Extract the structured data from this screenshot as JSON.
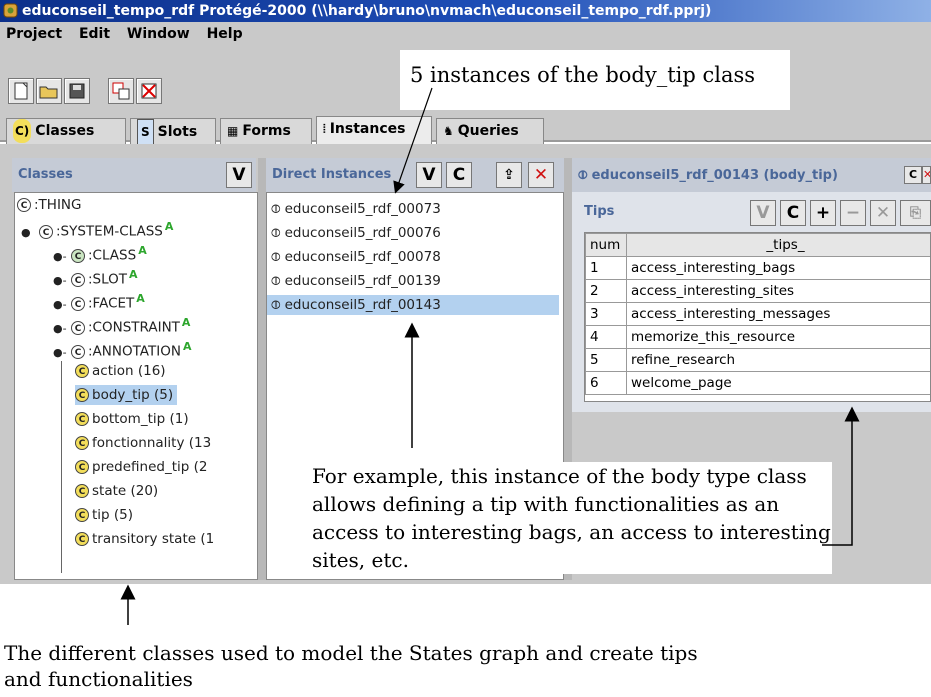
{
  "window": {
    "title": "educonseil_tempo_rdf  Protégé-2000   (\\\\hardy\\bruno\\nvmach\\educonseil_tempo_rdf.pprj)"
  },
  "menu": [
    "Project",
    "Edit",
    "Window",
    "Help"
  ],
  "tabs": [
    {
      "label": "Classes",
      "icon": "C)"
    },
    {
      "label": "Slots",
      "icon": "S"
    },
    {
      "label": "Forms",
      "icon": "▦"
    },
    {
      "label": "Instances",
      "icon": "⦙"
    },
    {
      "label": "Queries",
      "icon": "♞"
    }
  ],
  "classes_panel": {
    "header": "Classes",
    "view_button": "V",
    "tree": [
      {
        "label": ":THING",
        "icon": "C"
      },
      {
        "label": ":SYSTEM-CLASS",
        "icon": "C",
        "abstract": "A"
      },
      {
        "label": ":CLASS",
        "icon": "C",
        "abstract": "A"
      },
      {
        "label": ":SLOT",
        "icon": "C",
        "abstract": "A"
      },
      {
        "label": ":FACET",
        "icon": "C",
        "abstract": "A"
      },
      {
        "label": ":CONSTRAINT",
        "icon": "C",
        "abstract": "A"
      },
      {
        "label": ":ANNOTATION",
        "icon": "C",
        "abstract": "A"
      },
      {
        "label": "action  (16)",
        "icon": "C"
      },
      {
        "label": "body_tip  (5)",
        "icon": "C",
        "selected": true
      },
      {
        "label": "bottom_tip  (1)",
        "icon": "C"
      },
      {
        "label": "fonctionnality  (13",
        "icon": "C"
      },
      {
        "label": "predefined_tip  (2",
        "icon": "C"
      },
      {
        "label": "state  (20)",
        "icon": "C"
      },
      {
        "label": "tip  (5)",
        "icon": "C"
      },
      {
        "label": "transitory state  (1",
        "icon": "C"
      }
    ]
  },
  "instances_panel": {
    "header": "Direct Instances",
    "buttons": [
      "V",
      "C",
      "⇪",
      "✕"
    ],
    "items": [
      "educonseil5_rdf_00073",
      "educonseil5_rdf_00076",
      "educonseil5_rdf_00078",
      "educonseil5_rdf_00139",
      "educonseil5_rdf_00143"
    ],
    "selected_index": 4
  },
  "form_panel": {
    "header": "educonseil5_rdf_00143  (body_tip)",
    "header_buttons": [
      "C",
      "✕"
    ],
    "slot_label": "Tips",
    "slot_buttons": [
      "V",
      "C",
      "+",
      "−",
      "✕",
      "⎘"
    ],
    "table": {
      "columns": [
        "num",
        "_tips_"
      ],
      "rows": [
        [
          "1",
          "access_interesting_bags"
        ],
        [
          "2",
          "access_interesting_sites"
        ],
        [
          "3",
          "access_interesting_messages"
        ],
        [
          "4",
          "memorize_this_resource"
        ],
        [
          "5",
          "refine_research"
        ],
        [
          "6",
          "welcome_page"
        ]
      ]
    }
  },
  "annotations": {
    "top": "5 instances of the body_tip class",
    "middle": "For example, this instance of the body type class allows defining a tip with functionalities as an access to interesting bags, an access to interesting sites, etc.",
    "bottom": "The different classes used to model the States graph and create tips and functionalities"
  }
}
